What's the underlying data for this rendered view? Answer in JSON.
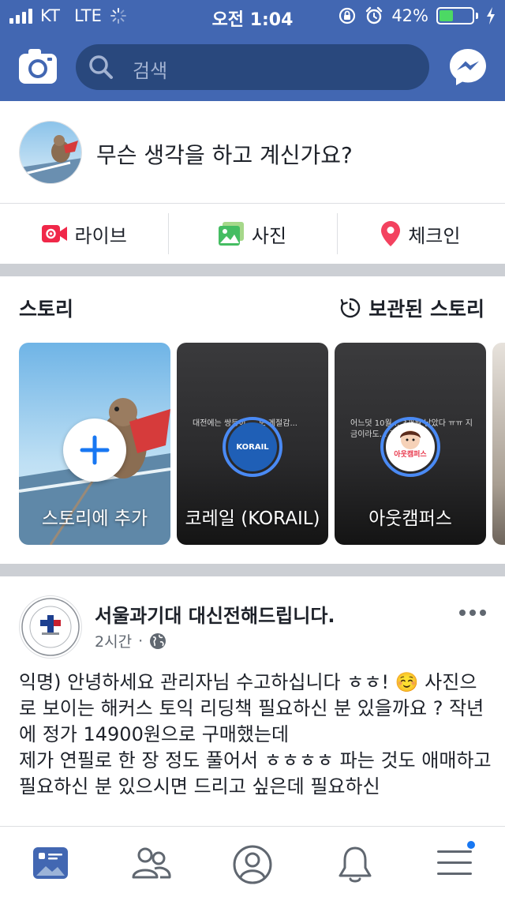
{
  "status_bar": {
    "carrier": "KT",
    "network": "LTE",
    "time": "오전 1:04",
    "battery_percent": "42%",
    "battery_level": 0.42
  },
  "header": {
    "search_placeholder": "검색",
    "icons": [
      "camera-icon",
      "search-icon",
      "messenger-icon"
    ]
  },
  "composer": {
    "prompt": "무슨 생각을 하고 계신가요?"
  },
  "actions": [
    {
      "label": "라이브",
      "icon": "live-video-icon",
      "color": "#f02849"
    },
    {
      "label": "사진",
      "icon": "photo-icon",
      "color": "#45bd62"
    },
    {
      "label": "체크인",
      "icon": "location-pin-icon",
      "color": "#f3425f"
    }
  ],
  "stories": {
    "title": "스토리",
    "archived_label": "보관된 스토리",
    "items": [
      {
        "label": "스토리에 추가"
      },
      {
        "label": "코레일 (KORAIL)",
        "avatar_text": "KORAIL",
        "preview": "대전에는 쌍둥이 ... 도 계절감..."
      },
      {
        "label": "아웃캠퍼스",
        "avatar_text": "아웃캠퍼스",
        "preview": "어느덧 10월... 3개월 남았다 ㅠㅠ 지금이라도... 지원 ㄱㄱ ..."
      }
    ]
  },
  "post": {
    "page_name": "서울과기대 대신전해드립니다.",
    "time": "2시간",
    "visibility_icon": "globe-icon",
    "body": "익명) 안녕하세요 관리자님 수고하십니다 ㅎㅎ! ☺️ 사진으로 보이는 해커스 토익 리딩책 필요하신 분 있을까요 ? 작년에 정가 14900원으로 구매했는데\n제가 연필로 한 장 정도 풀어서 ㅎㅎㅎㅎ 파는 것도 애매하고 필요하신 분 있으시면 드리고 싶은데 필요하신"
  },
  "tabbar": {
    "tabs": [
      "news-feed-icon",
      "friends-icon",
      "profile-icon",
      "notifications-icon",
      "menu-icon"
    ]
  },
  "colors": {
    "brand": "#4267b2",
    "search_bg": "#29487d",
    "separator": "#cccfd4"
  }
}
